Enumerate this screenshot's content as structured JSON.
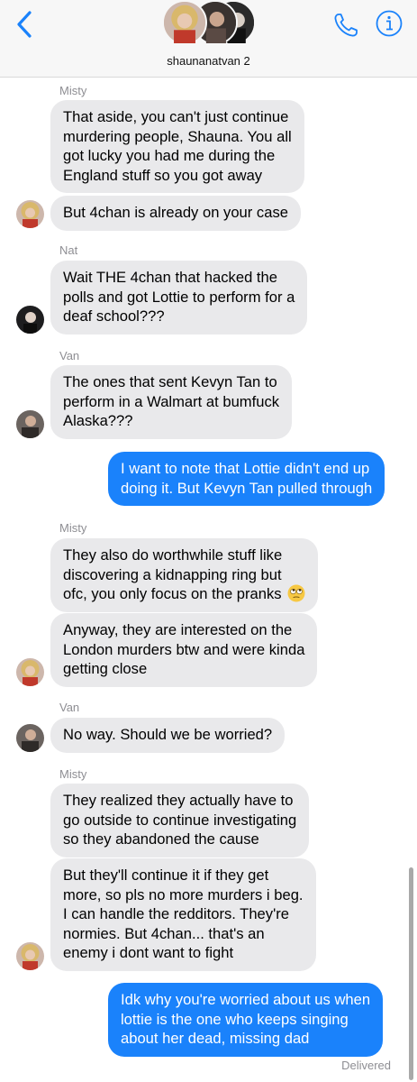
{
  "header": {
    "group_name": "shaunanatvan 2",
    "back_icon": "chevron-left-icon",
    "phone_icon": "phone-icon",
    "info_icon": "info-icon",
    "accent_color": "#1a82fb"
  },
  "messages": [
    {
      "sender": "Misty",
      "lines": [
        "That aside, you can't just continue",
        "murdering people, Shauna. You all",
        "got lucky you had me during the",
        "England stuff so you got away"
      ]
    },
    {
      "lines": [
        "But 4chan is already on your case"
      ]
    },
    {
      "sender": "Nat",
      "lines": [
        "Wait THE 4chan that hacked the",
        "polls and got Lottie to perform for a",
        "deaf school???"
      ]
    },
    {
      "sender": "Van",
      "lines": [
        "The ones that sent Kevyn Tan to",
        "perform in a Walmart at bumfuck",
        "Alaska???"
      ]
    },
    {
      "lines": [
        "I want to note that Lottie didn't end up",
        "doing it. But Kevyn Tan pulled through"
      ]
    },
    {
      "sender": "Misty",
      "lines": [
        "They also do worthwhile stuff like",
        "discovering a kidnapping ring but",
        "ofc, you only focus on the pranks"
      ],
      "emoji": "eye-roll-emoji-icon"
    },
    {
      "lines": [
        "Anyway, they are interested on the",
        "London murders btw and were kinda",
        "getting close"
      ]
    },
    {
      "sender": "Van",
      "lines": [
        "No way. Should we be worried?"
      ]
    },
    {
      "sender": "Misty",
      "lines": [
        "They realized they actually have to",
        "go outside to continue investigating",
        "so they abandoned the cause"
      ]
    },
    {
      "lines": [
        "But they'll continue it if they get",
        "more, so pls no more murders i beg.",
        "I can handle the redditors. They're",
        "normies. But 4chan... that's an",
        "enemy i dont want to fight"
      ]
    },
    {
      "lines": [
        "Idk why you're worried about us when",
        "lottie is the one who keeps singing",
        "about her dead, missing dad"
      ]
    }
  ],
  "status": "Delivered",
  "colors": {
    "incoming_bubble": "#e9e9eb",
    "outgoing_bubble": "#1a82fb",
    "sender_label": "#8e8e93"
  }
}
